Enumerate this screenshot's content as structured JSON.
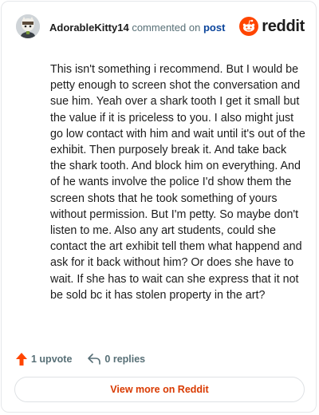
{
  "header": {
    "username": "AdorableKitty14",
    "action_text": "commented on",
    "post_link": "post",
    "brand_word": "reddit"
  },
  "comment": {
    "text": "This isn't something i recommend. But I would be petty enough to screen shot the conversation and sue him. Yeah over a shark tooth I get it small but the value if it is priceless to you. I also might just go low contact with him and wait until it's out of the exhibit. Then purposely break it. And take back the shark tooth. And block him on everything. And of he wants involve the police I'd show them the screen shots that he took something of yours without permission. But I'm petty. So maybe don't listen to me. Also any art students, could she contact the art exhibit tell them what happend and ask for it back without him? Or does she have to wait. If she has to wait can she express that it not be sold bc it has stolen property in the art?"
  },
  "actions": {
    "upvote_label": "1 upvote",
    "replies_label": "0 replies"
  },
  "footer": {
    "view_more_label": "View more on Reddit"
  },
  "icons": {
    "avatar": "avatar",
    "logo": "reddit-logo-icon",
    "upvote": "upvote-arrow-icon",
    "reply": "reply-arrow-icon"
  },
  "colors": {
    "brand_orange": "#ff4500",
    "upvote_orange": "#ff4500",
    "link_blue": "#0a449b",
    "button_text": "#d93a00"
  }
}
